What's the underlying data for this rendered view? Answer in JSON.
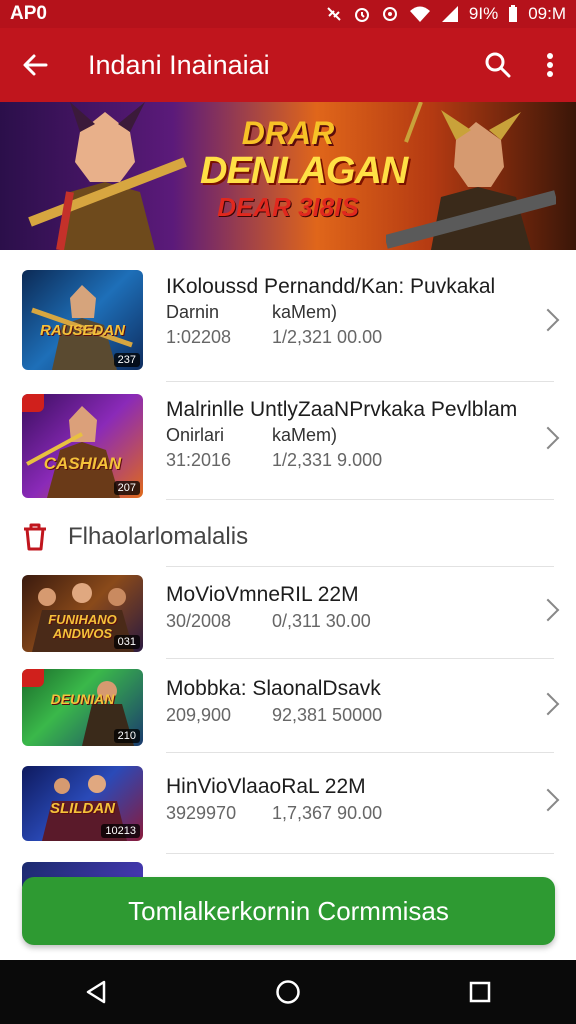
{
  "status_bar": {
    "left_text": "AP0",
    "battery": "9I%",
    "time": "09:M"
  },
  "app_bar": {
    "title": "Indani Inainaiai"
  },
  "banner": {
    "line1": "DRAR",
    "line2": "DENLAGAN",
    "line3": "DEAR 3I8IS"
  },
  "featured": [
    {
      "name": "IKoloussd Pernandd/Kan: Puvkakal",
      "sub1": "Darnin",
      "sub2": "kaMem)",
      "meta1": "1:02208",
      "meta2": "1/2,321 00.00",
      "thumb_label": "RAUSEDAN",
      "badge": "237"
    },
    {
      "name": "Malrinlle UntlyZaaNPrvkaka Pevlblam",
      "sub1": "Onirlari",
      "sub2": "kaMem)",
      "meta1": "31:2016",
      "meta2": "1/2,331 9.000",
      "thumb_label": "CASHIAN",
      "badge": "207"
    }
  ],
  "section": {
    "label": "Flhaolarlomalalis"
  },
  "list": [
    {
      "name": "MoVioVmneRIL 22M",
      "meta1": "30/2008",
      "meta2": "0/,311 30.00",
      "thumb_label": "FUNIHANO ANDWOS",
      "badge": "031"
    },
    {
      "name": "Mobbka: SlaonalDsavk",
      "meta1": "209,900",
      "meta2": "92,381 50000",
      "thumb_label": "DEUNIAN",
      "badge": "210"
    },
    {
      "name": "HinVioVlaaoRaL 22M",
      "meta1": "3929970",
      "meta2": "1,7,367 90.00",
      "thumb_label": "SLILDAN",
      "badge": "10213"
    }
  ],
  "cta": {
    "label": "Tomlalkerkornin Cormmisas"
  },
  "colors": {
    "primary": "#c0151d",
    "cta": "#2e9a32"
  }
}
